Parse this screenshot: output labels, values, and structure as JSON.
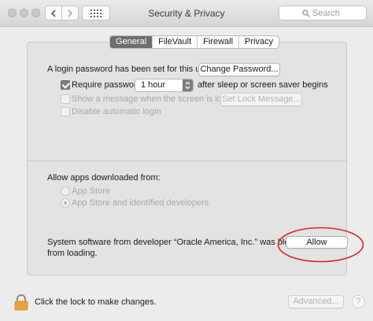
{
  "window": {
    "title": "Security & Privacy"
  },
  "search": {
    "placeholder": "Search"
  },
  "tabs": [
    {
      "label": "General",
      "active": true
    },
    {
      "label": "FileVault",
      "active": false
    },
    {
      "label": "Firewall",
      "active": false
    },
    {
      "label": "Privacy",
      "active": false
    }
  ],
  "login": {
    "password_text": "A login password has been set for this user",
    "change_password_label": "Change Password...",
    "require_password_label": "Require password",
    "require_password_value": "1 hour",
    "require_password_suffix": "after sleep or screen saver begins",
    "show_message_label": "Show a message when the screen is locked",
    "set_lock_message_label": "Set Lock Message...",
    "disable_auto_login_label": "Disable automatic login"
  },
  "allow_apps": {
    "heading": "Allow apps downloaded from:",
    "options": [
      {
        "label": "App Store",
        "selected": false
      },
      {
        "label": "App Store and identified developers",
        "selected": true
      }
    ]
  },
  "blocked": {
    "line1": "System software from developer “Oracle America, Inc.” was blocked",
    "line2": "from loading.",
    "allow_label": "Allow"
  },
  "footer": {
    "lock_text": "Click the lock to make changes.",
    "advanced_label": "Advanced..."
  },
  "colors": {
    "annotation": "#d9262b",
    "active_tab": "#6e6e6e",
    "lock": "#e8a33b"
  },
  "icons": {
    "window_controls": "traffic-light-circles",
    "back": "chevron-left-icon",
    "forward": "chevron-right-icon",
    "show_all": "grid-icon",
    "search": "magnifier-icon",
    "lock": "lock-icon"
  }
}
